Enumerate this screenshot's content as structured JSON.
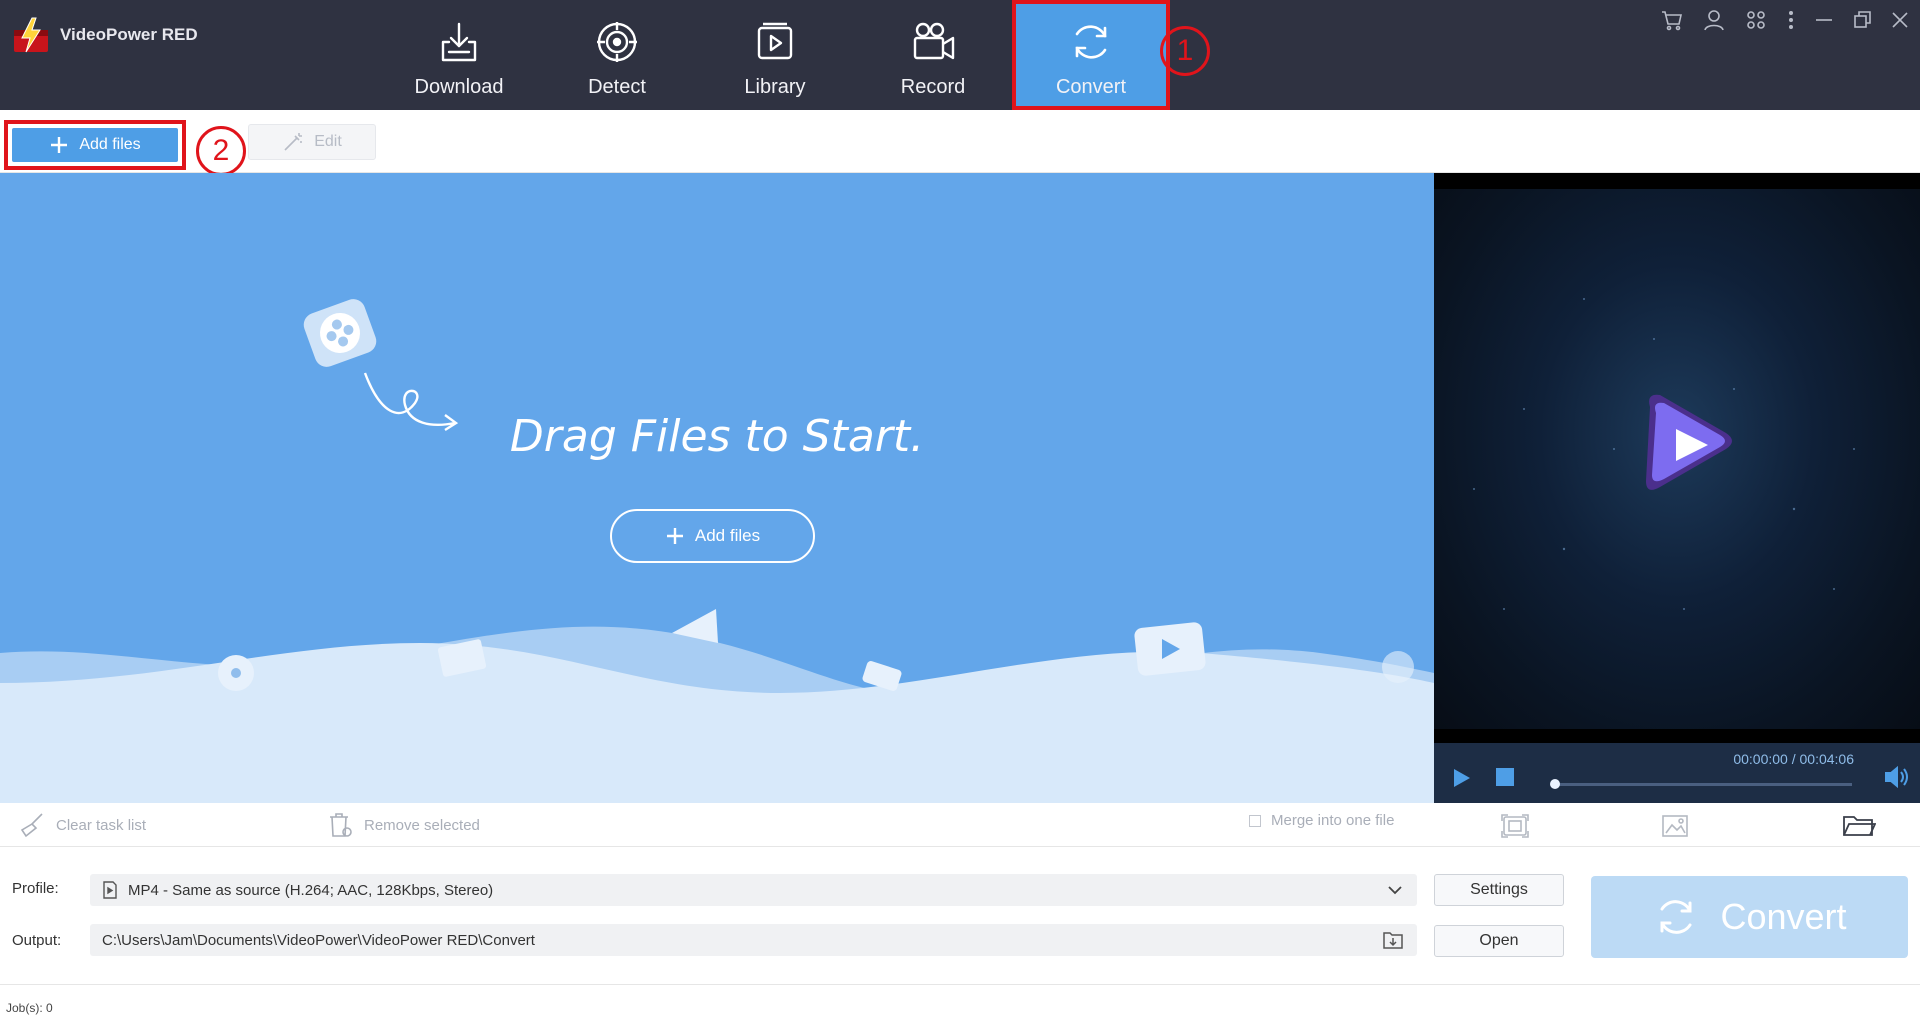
{
  "app": {
    "title": "VideoPower RED"
  },
  "nav": [
    {
      "id": "download",
      "label": "Download",
      "icon": "download-icon"
    },
    {
      "id": "detect",
      "label": "Detect",
      "icon": "detect-icon"
    },
    {
      "id": "library",
      "label": "Library",
      "icon": "library-icon"
    },
    {
      "id": "record",
      "label": "Record",
      "icon": "record-icon"
    },
    {
      "id": "convert",
      "label": "Convert",
      "icon": "convert-icon",
      "active": true
    }
  ],
  "annotations": {
    "step1": "1",
    "step2": "2"
  },
  "toolbar": {
    "add_files": "Add files",
    "edit": "Edit"
  },
  "dropzone": {
    "drag_text": "Drag Files to Start.",
    "add_files": "Add files"
  },
  "player": {
    "time": "00:00:00 / 00:04:06",
    "progress": 0.0
  },
  "listbar": {
    "clear": "Clear task list",
    "remove": "Remove selected",
    "merge": "Merge into one file"
  },
  "profile": {
    "label": "Profile:",
    "value": "MP4 - Same as source (H.264; AAC, 128Kbps, Stereo)",
    "settings": "Settings"
  },
  "output": {
    "label": "Output:",
    "value": "C:\\Users\\Jam\\Documents\\VideoPower\\VideoPower RED\\Convert",
    "open": "Open"
  },
  "convert_button": "Convert",
  "status": {
    "jobs": "Job(s): 0"
  },
  "colors": {
    "accent": "#4e9ee6",
    "annotation_red": "#e0141b",
    "topbar": "#2f3241",
    "dropzone": "#63a6ea"
  }
}
